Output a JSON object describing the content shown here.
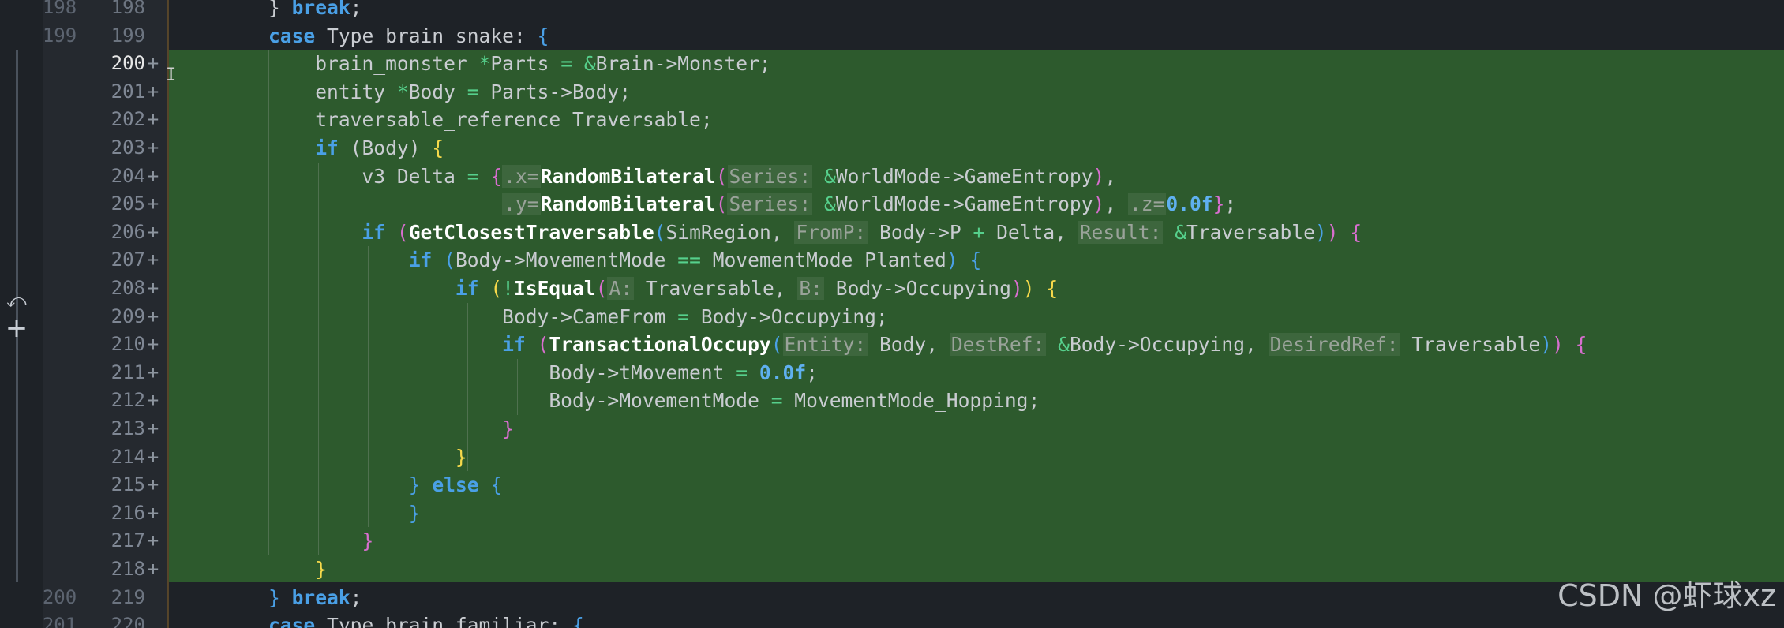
{
  "editor": {
    "gutter_icons": [
      "revert-icon",
      "add-icon"
    ],
    "revert_glyph": "⤺",
    "add_glyph": "+",
    "added_marker": "+",
    "watermark": "CSDN @虾球xz",
    "colors": {
      "background": "#1e2227",
      "added_line_bg": "#2d5a2d",
      "keyword": "#4aa0e6",
      "function": "#ffffff",
      "operator": "#56d08c",
      "number": "#5fb0f0",
      "bracket_yellow": "#f6d94b",
      "bracket_magenta": "#d86ecf"
    },
    "lines": [
      {
        "old": "198",
        "new": "198",
        "added": false,
        "tokens": [
          {
            "t": "} ",
            "c": ""
          },
          {
            "t": "break",
            "c": "kw"
          },
          {
            "t": ";",
            "c": ""
          }
        ]
      },
      {
        "old": "199",
        "new": "199",
        "added": false,
        "tokens": [
          {
            "t": "case ",
            "c": "kw"
          },
          {
            "t": "Type_brain_snake: ",
            "c": ""
          },
          {
            "t": "{",
            "c": "b3"
          }
        ]
      },
      {
        "old": "",
        "new": "200",
        "added": true,
        "current": true,
        "tokens": [
          {
            "t": "    brain_monster ",
            "c": ""
          },
          {
            "t": "*",
            "c": "op"
          },
          {
            "t": "Parts ",
            "c": ""
          },
          {
            "t": "=",
            "c": "op"
          },
          {
            "t": " ",
            "c": ""
          },
          {
            "t": "&",
            "c": "op"
          },
          {
            "t": "Brain->Monster;",
            "c": ""
          }
        ]
      },
      {
        "old": "",
        "new": "201",
        "added": true,
        "tokens": [
          {
            "t": "    entity ",
            "c": ""
          },
          {
            "t": "*",
            "c": "op"
          },
          {
            "t": "Body ",
            "c": ""
          },
          {
            "t": "=",
            "c": "op"
          },
          {
            "t": " Parts->Body;",
            "c": ""
          }
        ]
      },
      {
        "old": "",
        "new": "202",
        "added": true,
        "tokens": [
          {
            "t": "    traversable_reference Traversable;",
            "c": ""
          }
        ]
      },
      {
        "old": "",
        "new": "203",
        "added": true,
        "tokens": [
          {
            "t": "    ",
            "c": ""
          },
          {
            "t": "if",
            "c": "kw"
          },
          {
            "t": " (Body) ",
            "c": ""
          },
          {
            "t": "{",
            "c": "b1"
          }
        ]
      },
      {
        "old": "",
        "new": "204",
        "added": true,
        "tokens": [
          {
            "t": "        v3 Delta ",
            "c": ""
          },
          {
            "t": "=",
            "c": "op"
          },
          {
            "t": " ",
            "c": ""
          },
          {
            "t": "{",
            "c": "b2"
          },
          {
            "t": ".x=",
            "c": "hint"
          },
          {
            "t": "RandomBilateral",
            "c": "fn"
          },
          {
            "t": "(",
            "c": "b2"
          },
          {
            "t": "Series:",
            "c": "hint"
          },
          {
            "t": " ",
            "c": ""
          },
          {
            "t": "&",
            "c": "op"
          },
          {
            "t": "WorldMode->GameEntropy",
            "c": ""
          },
          {
            "t": ")",
            "c": "b2"
          },
          {
            "t": ",",
            "c": ""
          }
        ]
      },
      {
        "old": "",
        "new": "205",
        "added": true,
        "tokens": [
          {
            "t": "                    ",
            "c": ""
          },
          {
            "t": ".y=",
            "c": "hint"
          },
          {
            "t": "RandomBilateral",
            "c": "fn"
          },
          {
            "t": "(",
            "c": "b2"
          },
          {
            "t": "Series:",
            "c": "hint"
          },
          {
            "t": " ",
            "c": ""
          },
          {
            "t": "&",
            "c": "op"
          },
          {
            "t": "WorldMode->GameEntropy",
            "c": ""
          },
          {
            "t": ")",
            "c": "b2"
          },
          {
            "t": ", ",
            "c": ""
          },
          {
            "t": ".z=",
            "c": "hint"
          },
          {
            "t": "0.0f",
            "c": "num"
          },
          {
            "t": "}",
            "c": "b2"
          },
          {
            "t": ";",
            "c": ""
          }
        ]
      },
      {
        "old": "",
        "new": "206",
        "added": true,
        "tokens": [
          {
            "t": "        ",
            "c": ""
          },
          {
            "t": "if",
            "c": "kw"
          },
          {
            "t": " (",
            "c": "b2"
          },
          {
            "t": "GetClosestTraversable",
            "c": "fn"
          },
          {
            "t": "(",
            "c": "b3"
          },
          {
            "t": "SimRegion, ",
            "c": ""
          },
          {
            "t": "FromP:",
            "c": "hint"
          },
          {
            "t": " Body->P ",
            "c": ""
          },
          {
            "t": "+",
            "c": "op"
          },
          {
            "t": " Delta, ",
            "c": ""
          },
          {
            "t": "Result:",
            "c": "hint"
          },
          {
            "t": " ",
            "c": ""
          },
          {
            "t": "&",
            "c": "op"
          },
          {
            "t": "Traversable",
            "c": ""
          },
          {
            "t": ")",
            "c": "b3"
          },
          {
            "t": ")",
            "c": "b2"
          },
          {
            "t": " ",
            "c": ""
          },
          {
            "t": "{",
            "c": "b2"
          }
        ]
      },
      {
        "old": "",
        "new": "207",
        "added": true,
        "tokens": [
          {
            "t": "            ",
            "c": ""
          },
          {
            "t": "if",
            "c": "kw"
          },
          {
            "t": " (",
            "c": "b3"
          },
          {
            "t": "Body->MovementMode ",
            "c": ""
          },
          {
            "t": "==",
            "c": "op"
          },
          {
            "t": " MovementMode_Planted",
            "c": ""
          },
          {
            "t": ")",
            "c": "b3"
          },
          {
            "t": " ",
            "c": ""
          },
          {
            "t": "{",
            "c": "b3"
          }
        ]
      },
      {
        "old": "",
        "new": "208",
        "added": true,
        "tokens": [
          {
            "t": "                ",
            "c": ""
          },
          {
            "t": "if",
            "c": "kw"
          },
          {
            "t": " (",
            "c": "b1"
          },
          {
            "t": "!",
            "c": "op"
          },
          {
            "t": "IsEqual",
            "c": "fn"
          },
          {
            "t": "(",
            "c": "b2"
          },
          {
            "t": "A:",
            "c": "hint"
          },
          {
            "t": " Traversable, ",
            "c": ""
          },
          {
            "t": "B:",
            "c": "hint"
          },
          {
            "t": " Body->Occupying",
            "c": ""
          },
          {
            "t": ")",
            "c": "b2"
          },
          {
            "t": ")",
            "c": "b1"
          },
          {
            "t": " ",
            "c": ""
          },
          {
            "t": "{",
            "c": "b1"
          }
        ]
      },
      {
        "old": "",
        "new": "209",
        "added": true,
        "tokens": [
          {
            "t": "                    Body->CameFrom ",
            "c": ""
          },
          {
            "t": "=",
            "c": "op"
          },
          {
            "t": " Body->Occupying;",
            "c": ""
          }
        ]
      },
      {
        "old": "",
        "new": "210",
        "added": true,
        "tokens": [
          {
            "t": "                    ",
            "c": ""
          },
          {
            "t": "if",
            "c": "kw"
          },
          {
            "t": " (",
            "c": "b2"
          },
          {
            "t": "TransactionalOccupy",
            "c": "fn"
          },
          {
            "t": "(",
            "c": "b3"
          },
          {
            "t": "Entity:",
            "c": "hint"
          },
          {
            "t": " Body, ",
            "c": ""
          },
          {
            "t": "DestRef:",
            "c": "hint"
          },
          {
            "t": " ",
            "c": ""
          },
          {
            "t": "&",
            "c": "op"
          },
          {
            "t": "Body->Occupying, ",
            "c": ""
          },
          {
            "t": "DesiredRef:",
            "c": "hint"
          },
          {
            "t": " Traversable",
            "c": ""
          },
          {
            "t": ")",
            "c": "b3"
          },
          {
            "t": ")",
            "c": "b2"
          },
          {
            "t": " ",
            "c": ""
          },
          {
            "t": "{",
            "c": "b2"
          }
        ]
      },
      {
        "old": "",
        "new": "211",
        "added": true,
        "tokens": [
          {
            "t": "                        Body->tMovement ",
            "c": ""
          },
          {
            "t": "=",
            "c": "op"
          },
          {
            "t": " ",
            "c": ""
          },
          {
            "t": "0.0f",
            "c": "num"
          },
          {
            "t": ";",
            "c": ""
          }
        ]
      },
      {
        "old": "",
        "new": "212",
        "added": true,
        "tokens": [
          {
            "t": "                        Body->MovementMode ",
            "c": ""
          },
          {
            "t": "=",
            "c": "op"
          },
          {
            "t": " MovementMode_Hopping;",
            "c": ""
          }
        ]
      },
      {
        "old": "",
        "new": "213",
        "added": true,
        "tokens": [
          {
            "t": "                    ",
            "c": ""
          },
          {
            "t": "}",
            "c": "b2"
          }
        ]
      },
      {
        "old": "",
        "new": "214",
        "added": true,
        "tokens": [
          {
            "t": "                ",
            "c": ""
          },
          {
            "t": "}",
            "c": "b1"
          }
        ]
      },
      {
        "old": "",
        "new": "215",
        "added": true,
        "tokens": [
          {
            "t": "            ",
            "c": ""
          },
          {
            "t": "}",
            "c": "b3"
          },
          {
            "t": " ",
            "c": ""
          },
          {
            "t": "else",
            "c": "kw"
          },
          {
            "t": " ",
            "c": ""
          },
          {
            "t": "{",
            "c": "b3"
          }
        ]
      },
      {
        "old": "",
        "new": "216",
        "added": true,
        "tokens": [
          {
            "t": "            ",
            "c": ""
          },
          {
            "t": "}",
            "c": "b3"
          }
        ]
      },
      {
        "old": "",
        "new": "217",
        "added": true,
        "tokens": [
          {
            "t": "        ",
            "c": ""
          },
          {
            "t": "}",
            "c": "b2"
          }
        ]
      },
      {
        "old": "",
        "new": "218",
        "added": true,
        "tokens": [
          {
            "t": "    ",
            "c": ""
          },
          {
            "t": "}",
            "c": "b1"
          }
        ]
      },
      {
        "old": "200",
        "new": "219",
        "added": false,
        "tokens": [
          {
            "t": "} ",
            "c": "b3"
          },
          {
            "t": "break",
            "c": "kw"
          },
          {
            "t": ";",
            "c": ""
          }
        ]
      },
      {
        "old": "201",
        "new": "220",
        "added": false,
        "tokens": [
          {
            "t": "case ",
            "c": "kw"
          },
          {
            "t": "Type_brain_familiar: ",
            "c": ""
          },
          {
            "t": "{",
            "c": "b3"
          }
        ]
      }
    ]
  }
}
